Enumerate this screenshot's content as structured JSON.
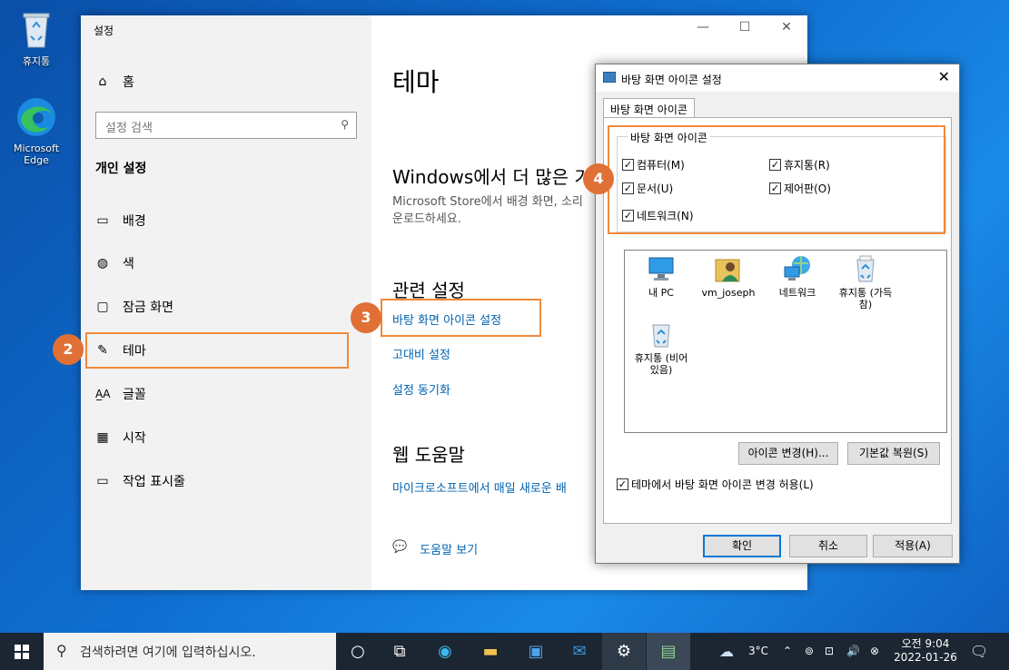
{
  "desktop": {
    "icons": [
      {
        "label": "휴지통",
        "icon": "recycle-bin-icon"
      },
      {
        "label": "Microsoft Edge",
        "icon": "edge-icon"
      }
    ]
  },
  "settings": {
    "title": "설정",
    "home": "홈",
    "search_placeholder": "설정 검색",
    "group": "개인 설정",
    "nav": [
      {
        "label": "배경",
        "icon": "picture-icon"
      },
      {
        "label": "색",
        "icon": "palette-icon"
      },
      {
        "label": "잠금 화면",
        "icon": "lock-screen-icon"
      },
      {
        "label": "테마",
        "icon": "theme-brush-icon"
      },
      {
        "label": "글꼴",
        "icon": "font-icon"
      },
      {
        "label": "시작",
        "icon": "start-grid-icon"
      },
      {
        "label": "작업 표시줄",
        "icon": "taskbar-icon"
      }
    ],
    "page_title": "테마",
    "more_themes_heading": "Windows에서 더 많은 기",
    "more_themes_text_1": "Microsoft Store에서 배경 화면, 소리",
    "more_themes_text_2": "운로드하세요.",
    "related_heading": "관련 설정",
    "related_links": [
      "바탕 화면 아이콘 설정",
      "고대비 설정",
      "설정 동기화"
    ],
    "web_help_heading": "웹 도움말",
    "web_help_link": "마이크로소프트에서 매일 새로운 배",
    "help_link": "도움말 보기"
  },
  "badges": [
    "2",
    "3",
    "4"
  ],
  "dialog": {
    "title": "바탕 화면 아이콘 설정",
    "tab": "바탕 화면 아이콘",
    "group_label": "바탕 화면 아이콘",
    "checkboxes": [
      {
        "label": "컴퓨터(M)",
        "checked": true
      },
      {
        "label": "휴지통(R)",
        "checked": true
      },
      {
        "label": "문서(U)",
        "checked": true
      },
      {
        "label": "제어판(O)",
        "checked": true
      },
      {
        "label": "네트워크(N)",
        "checked": true
      }
    ],
    "icons": [
      {
        "label": "내 PC",
        "icon": "pc-icon"
      },
      {
        "label": "vm_joseph",
        "icon": "user-folder-icon"
      },
      {
        "label": "네트워크",
        "icon": "network-icon"
      },
      {
        "label": "휴지통 (가득 참)",
        "icon": "recycle-full-icon"
      },
      {
        "label": "휴지통 (비어 있음)",
        "icon": "recycle-empty-icon"
      }
    ],
    "change_icon": "아이콘 변경(H)...",
    "restore_default": "기본값 복원(S)",
    "allow_themes": "테마에서 바탕 화면 아이콘 변경 허용(L)",
    "allow_themes_checked": true,
    "ok": "확인",
    "cancel": "취소",
    "apply": "적용(A)"
  },
  "taskbar": {
    "search_placeholder": "검색하려면 여기에 입력하십시오.",
    "weather": "3°C",
    "time": "오전 9:04",
    "date": "2022-01-26"
  }
}
